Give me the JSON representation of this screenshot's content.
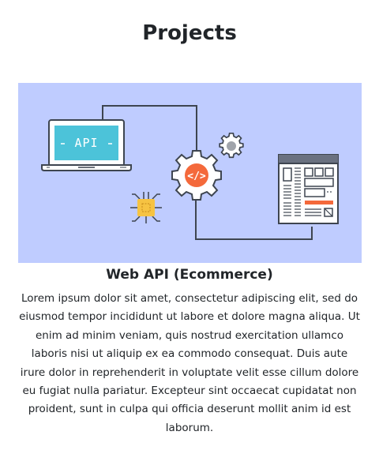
{
  "page": {
    "title": "Projects"
  },
  "projects": [
    {
      "title": "Web API (Ecommerce)",
      "description": "Lorem ipsum dolor sit amet, consectetur adipiscing elit, sed do eiusmod tempor incididunt ut labore et dolore magna aliqua. Ut enim ad minim veniam, quis nostrud exercitation ullamco laboris nisi ut aliquip ex ea commodo consequat. Duis aute irure dolor in reprehenderit in voluptate velit esse cillum dolore eu fugiat nulla pariatur. Excepteur sint occaecat cupidatat non proident, sunt in culpa qui officia deserunt mollit anim id est laborum.",
      "illustration": {
        "laptop_screen_text": "API",
        "code_symbol": "</>",
        "icons": [
          "laptop-icon",
          "gear-icon",
          "small-gear-icon",
          "chip-icon",
          "webpage-layout-icon"
        ],
        "colors": {
          "background": "#bfccff",
          "screen": "#4cc3d9",
          "gear_center": "#f4693b",
          "chip": "#f6c342",
          "outline": "#3e4550"
        }
      }
    }
  ]
}
